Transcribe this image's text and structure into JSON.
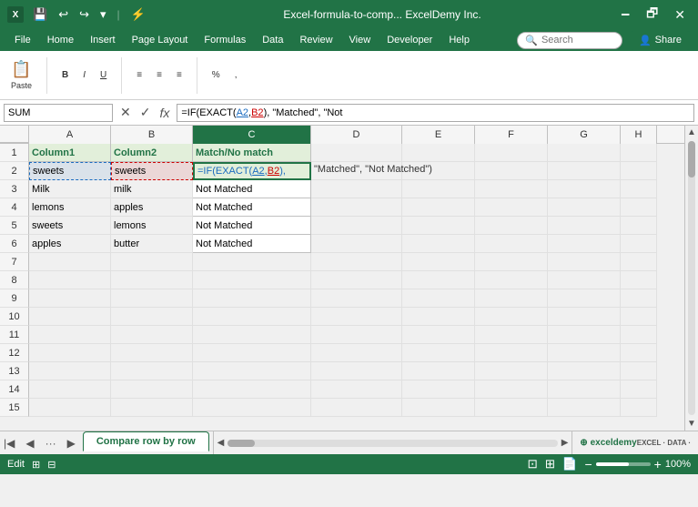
{
  "title_bar": {
    "title": "Excel-formula-to-comp...   ExcelDemy Inc.",
    "file_icon": "💾",
    "quick_access": [
      "💾",
      "↩",
      "↪",
      "⚡"
    ],
    "window_controls": [
      "🗕",
      "🗗",
      "✕"
    ]
  },
  "menu": {
    "items": [
      "File",
      "Home",
      "Insert",
      "Page Layout",
      "Formulas",
      "Data",
      "Review",
      "View",
      "Developer",
      "Help"
    ]
  },
  "ribbon": {
    "search_placeholder": "Search",
    "share_label": "Share"
  },
  "formula_bar": {
    "name_box": "SUM",
    "formula": "=IF(EXACT(A2,B2), \"Matched\", \"Not",
    "formula_full": "=IF(EXACT(A2,B2), \"Matched\", \"Not Matched\")"
  },
  "columns": {
    "headers": [
      "A",
      "B",
      "C",
      "D",
      "E",
      "F",
      "G",
      "H"
    ]
  },
  "rows": [
    {
      "num": 1,
      "cells": [
        "Column1",
        "Column2",
        "Match/No match",
        "",
        "",
        "",
        "",
        ""
      ]
    },
    {
      "num": 2,
      "cells": [
        "sweets",
        "sweets",
        "=IF(EXACT(A2,B2), \"Matched\", \"Not Matched\")",
        "",
        "",
        "",
        "",
        ""
      ]
    },
    {
      "num": 3,
      "cells": [
        "Milk",
        "milk",
        "Not Matched",
        "",
        "",
        "",
        "",
        ""
      ]
    },
    {
      "num": 4,
      "cells": [
        "lemons",
        "apples",
        "Not Matched",
        "",
        "",
        "",
        "",
        ""
      ]
    },
    {
      "num": 5,
      "cells": [
        "sweets",
        "lemons",
        "Not Matched",
        "",
        "",
        "",
        "",
        ""
      ]
    },
    {
      "num": 6,
      "cells": [
        "apples",
        "butter",
        "Not Matched",
        "",
        "",
        "",
        "",
        ""
      ]
    },
    {
      "num": 7,
      "cells": [
        "",
        "",
        "",
        "",
        "",
        "",
        "",
        ""
      ]
    },
    {
      "num": 8,
      "cells": [
        "",
        "",
        "",
        "",
        "",
        "",
        "",
        ""
      ]
    },
    {
      "num": 9,
      "cells": [
        "",
        "",
        "",
        "",
        "",
        "",
        "",
        ""
      ]
    },
    {
      "num": 10,
      "cells": [
        "",
        "",
        "",
        "",
        "",
        "",
        "",
        ""
      ]
    },
    {
      "num": 11,
      "cells": [
        "",
        "",
        "",
        "",
        "",
        "",
        "",
        ""
      ]
    },
    {
      "num": 12,
      "cells": [
        "",
        "",
        "",
        "",
        "",
        "",
        "",
        ""
      ]
    },
    {
      "num": 13,
      "cells": [
        "",
        "",
        "",
        "",
        "",
        "",
        "",
        ""
      ]
    },
    {
      "num": 14,
      "cells": [
        "",
        "",
        "",
        "",
        "",
        "",
        "",
        ""
      ]
    },
    {
      "num": 15,
      "cells": [
        "",
        "",
        "",
        "",
        "",
        "",
        "",
        ""
      ]
    }
  ],
  "sheet_tabs": {
    "nav_btns": [
      "◀◀",
      "◀",
      "▶",
      "▶▶"
    ],
    "tabs": [
      "Compare row by row"
    ],
    "active_tab": "Compare row by row"
  },
  "status_bar": {
    "mode": "Edit",
    "zoom": "100%",
    "view_icons": [
      "📋",
      "⊞",
      "📄"
    ]
  },
  "formula_overlay": {
    "prefix": "=IF(EXACT(",
    "a2": "A2",
    "comma": ",",
    "b2": "B2",
    "suffix": "), \"Matched\", \"Not Matched\")"
  }
}
